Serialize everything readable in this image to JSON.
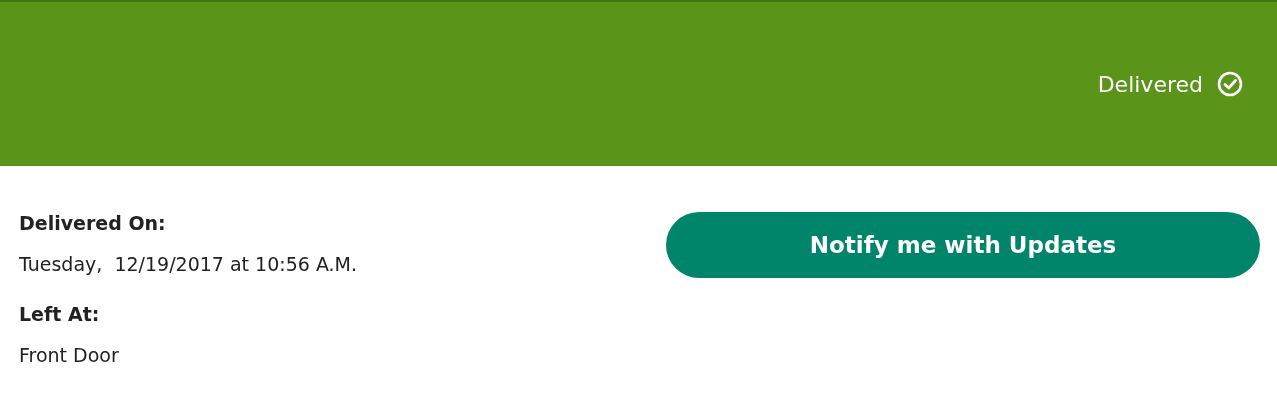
{
  "banner": {
    "status": "Delivered"
  },
  "details": [
    {
      "label": "Delivered On:",
      "value": "Tuesday,  12/19/2017 at 10:56 A.M."
    },
    {
      "label": "Left At:",
      "value": "Front Door"
    }
  ],
  "buttons": [
    "Notify me with Updates"
  ]
}
